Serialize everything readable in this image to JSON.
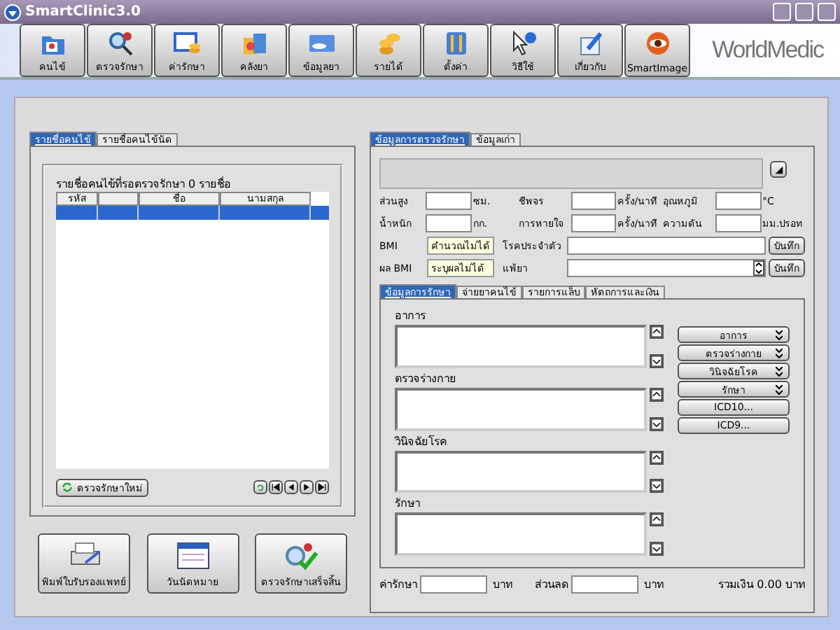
{
  "window": {
    "title": "SmartClinic3.0"
  },
  "toolbar": [
    {
      "label": "คนไข้"
    },
    {
      "label": "ตรวจรักษา"
    },
    {
      "label": "ค่ารักษา"
    },
    {
      "label": "คลังยา"
    },
    {
      "label": "ข้อมูลยา"
    },
    {
      "label": "รายได้"
    },
    {
      "label": "ตั้งค่า"
    },
    {
      "label": "วิธีใช้"
    },
    {
      "label": "เกี่ยวกับ"
    },
    {
      "label": "SmartImage"
    }
  ],
  "logo": "WorldMedic",
  "patients": {
    "tabs": [
      {
        "label": "รายชื่อคนไข้",
        "selected": true
      },
      {
        "label": "รายชื่อคนไข้นัด",
        "selected": false
      }
    ],
    "caption": "รายชื่อคนไข้ที่รอตรวจรักษา 0 รายชื่อ",
    "columns": [
      {
        "kind": "text",
        "label": "รหัส"
      },
      {
        "kind": "blank"
      },
      {
        "kind": "text",
        "label": "ชื่อ"
      },
      {
        "kind": "text",
        "label": "นามสกุล"
      }
    ],
    "rows": [
      {
        "selected": true
      }
    ],
    "new_button": "ตรวจรักษาใหม่",
    "actions": [
      "พิมพ์ใบรับรองแพทย์",
      "วันนัดหมาย",
      "ตรวจรักษาเสร็จสิ้น"
    ]
  },
  "exam": {
    "tabs": [
      {
        "label": "ข้อมูลการตรวจรักษา",
        "selected": true
      },
      {
        "label": "ข้อมูลเก่า",
        "selected": false
      }
    ],
    "vitals": [
      [
        {
          "label": "ส่วนสูง",
          "unit": "ซม."
        },
        {
          "label": "ชีพจร",
          "unit": "ครั้ง/นาที"
        },
        {
          "label": "อุณหภูมิ",
          "unit": "°C"
        }
      ],
      [
        {
          "label": "น้ำหนัก",
          "unit": "กก."
        },
        {
          "label": "การหายใจ",
          "unit": "ครั้ง/นาที"
        },
        {
          "label": "ความดัน",
          "unit": "มม.ปรอท"
        }
      ]
    ],
    "bmi_rows": [
      {
        "label": "BMI",
        "value": "คำนวณไม่ได้",
        "field": "โรคประจำตัว",
        "kind": "text",
        "button": "บันทึก"
      },
      {
        "label": "ผล BMI",
        "value": "ระบุผลไม่ได้",
        "field": "แพ้ยา",
        "kind": "spin",
        "button": "บันทึก"
      }
    ],
    "subtabs": [
      {
        "label": "ข้อมูลการรักษา",
        "selected": true
      },
      {
        "label": "จ่ายยาคนไข้",
        "selected": false
      },
      {
        "label": "รายการแล็บ",
        "selected": false
      },
      {
        "label": "หัตถการและเงิน",
        "selected": false
      }
    ],
    "sections": [
      "อาการ",
      "ตรวจร่างกาย",
      "วินิจฉัยโรค",
      "รักษา"
    ],
    "side_buttons": [
      {
        "label": "อาการ",
        "kind": "dropdown"
      },
      {
        "label": "ตรวจร่างกาย",
        "kind": "dropdown"
      },
      {
        "label": "วินิจฉัยโรค",
        "kind": "dropdown"
      },
      {
        "label": "รักษา",
        "kind": "dropdown"
      },
      {
        "label": "ICD10...",
        "kind": "plain"
      },
      {
        "label": "ICD9...",
        "kind": "plain"
      }
    ],
    "footer": {
      "fee_label": "ค่ารักษา",
      "fee_unit": "บาท",
      "discount_label": "ส่วนลด",
      "discount_unit": "บาท",
      "total": "รวมเงิน 0.00 บาท"
    }
  }
}
